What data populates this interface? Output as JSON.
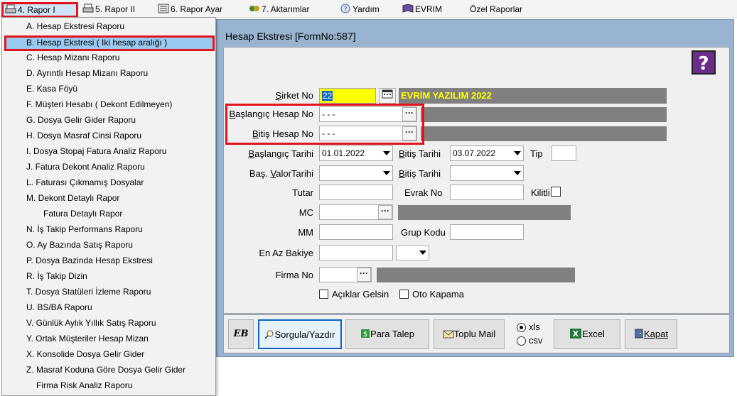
{
  "menubar": {
    "items": [
      "4.  Rapor I",
      "5.  Rapor II",
      "6.  Rapor Ayar",
      "7.  Aktarımlar",
      "Yardım",
      "EVRIM",
      "Özel Raporlar"
    ]
  },
  "dropdown": {
    "items": [
      "A.  Hesap Ekstresi Raporu",
      "B.  Hesap Ekstresi ( Iki hesap aralığı )",
      "C.  Hesap Mizanı Raporu",
      "D.  Ayrıntlı Hesap Mizanı Raporu",
      "E.  Kasa Föyü",
      "F.  Müşteri Hesabı ( Dekont Edilmeyen)",
      "G.  Dosya Gelir Gider Raporu",
      "H.  Dosya Masraf Cinsi Raporu",
      "I.  Dosya Stopaj Fatura Analiz Raporu",
      "J.  Fatura Dekont Analiz Raporu",
      "L.  Faturası Çıkmamış Dosyalar",
      "M.  Dekont Detaylı Rapor",
      "Fatura Detaylı Rapor",
      "N.  İş Takip Performans Raporu",
      "O.  Ay Bazında Satış Raporu",
      "P.  Dosya Bazinda Hesap Ekstresi",
      "R.  İş Takip Dizin",
      "T.  Dosya Statüleri İzleme Raporu",
      "U.  BS/BA Raporu",
      "V. Günlük Aylık Yıllık Satış Raporu",
      "Y. Ortak Müşteriler Hesap Mizan",
      "X. Konsolide Dosya Gelir Gider",
      "Z. Masraf Koduna Göre Dosya Gelir Gider",
      "Firma Risk Analiz Raporu"
    ]
  },
  "form": {
    "title": "Hesap Ekstresi [FormNo:587]",
    "sirket_label": "Şirket No",
    "sirket_value": "22",
    "sirket_name": "EVRİM YAZILIM  2022",
    "bas_hesap_label": "Başlangıç Hesap No",
    "bas_hesap_value": "- - -",
    "bitis_hesap_label": "Bitiş Hesap No",
    "bitis_hesap_value": "- - -",
    "bas_tarih_label": "Başlangıç Tarihi",
    "bas_tarih_value": "01.01.2022",
    "bitis_tarih_label": "Bitiş Tarihi",
    "bitis_tarih_value": "03.07.2022",
    "tip_label": "Tip",
    "bas_valor_label": "Baş. ValorTarihi",
    "bitis_tarih2_label": "Bitiş Tarihi",
    "tutar_label": "Tutar",
    "evrak_label": "Evrak No",
    "kilitli_label": "Kilitli",
    "mc_label": "MC",
    "mm_label": "MM",
    "grup_label": "Grup Kodu",
    "enaz_label": "En Az Bakiye",
    "firma_label": "Firma No",
    "aciklar_label": "Açıklar Gelsin",
    "oto_label": "Oto Kapama",
    "dots": "···"
  },
  "buttons": {
    "sorgula": "Sorgula/Yazdır",
    "para": "Para Talep",
    "toplu": "Toplu Mail",
    "xls": "xls",
    "csv": "csv",
    "excel": "Excel",
    "kapat": "Kapat",
    "eb": "EB"
  },
  "colors": {
    "accent_red": "#e0141b",
    "highlight_yellow": "#ffff00",
    "window_blue": "#99b4d1"
  }
}
